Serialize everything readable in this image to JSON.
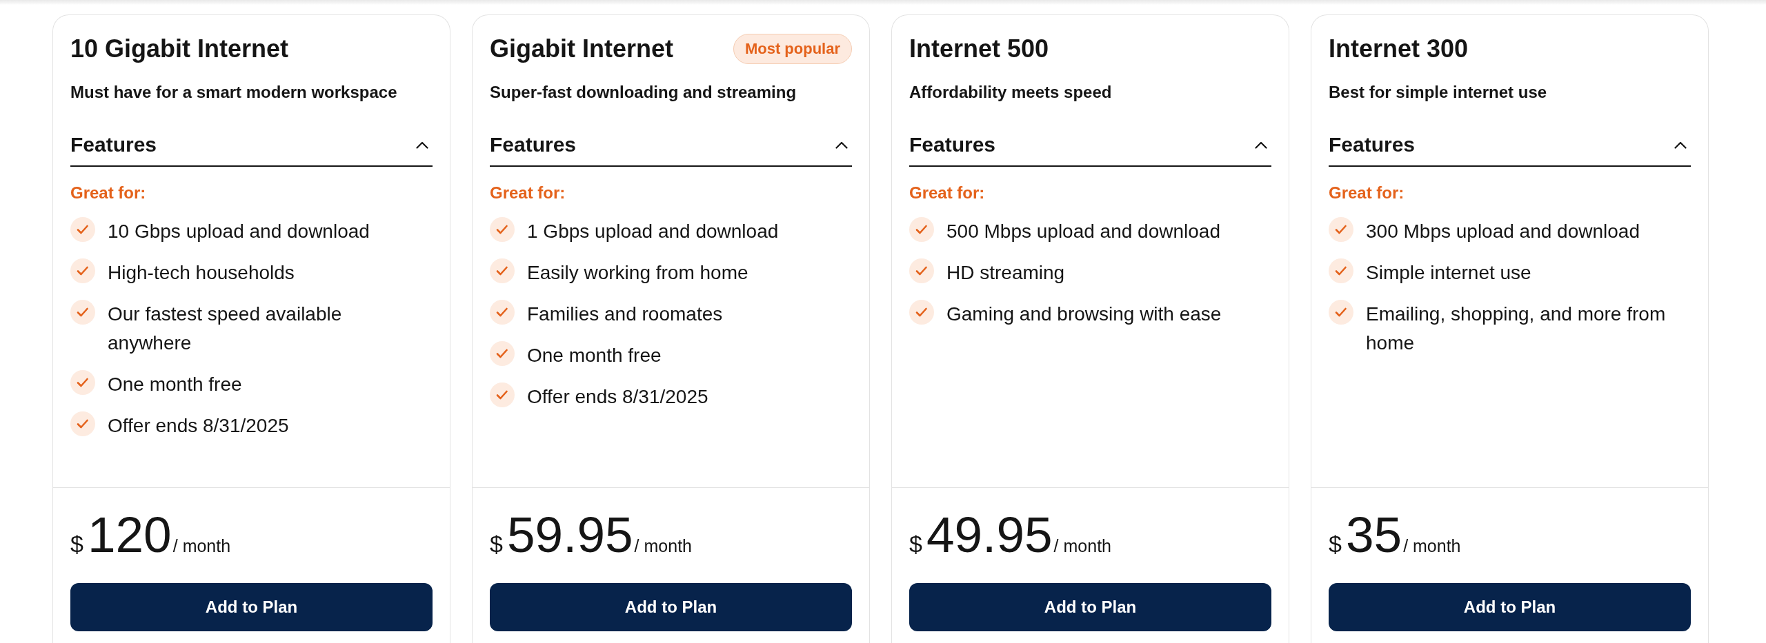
{
  "plans": [
    {
      "name": "10 Gigabit Internet",
      "tagline": "Must have for a smart modern workspace",
      "features_label": "Features",
      "features_expanded": true,
      "features_heading": "Great for:",
      "features": [
        "10 Gbps upload and download",
        "High-tech households",
        "Our fastest speed available anywhere",
        "One month free",
        "Offer ends 8/31/2025"
      ],
      "price": {
        "currency": "$",
        "amount": "120",
        "period": "/ month"
      },
      "button": "Add to Plan"
    },
    {
      "name": "Gigabit Internet",
      "badge": "Most popular",
      "tagline": "Super-fast downloading and streaming",
      "features_label": "Features",
      "features_expanded": true,
      "features_heading": "Great for:",
      "features": [
        "1 Gbps upload and download",
        "Easily working from home",
        "Families and roomates",
        "One month free",
        "Offer ends 8/31/2025"
      ],
      "price": {
        "currency": "$",
        "amount": "59.95",
        "period": "/ month"
      },
      "button": "Add to Plan"
    },
    {
      "name": "Internet 500",
      "tagline": "Affordability meets speed",
      "features_label": "Features",
      "features_expanded": true,
      "features_heading": "Great for:",
      "features": [
        "500 Mbps upload and download",
        "HD streaming",
        "Gaming and browsing with ease"
      ],
      "price": {
        "currency": "$",
        "amount": "49.95",
        "period": "/ month"
      },
      "button": "Add to Plan"
    },
    {
      "name": "Internet 300",
      "tagline": "Best for simple internet use",
      "features_label": "Features",
      "features_expanded": true,
      "features_heading": "Great for:",
      "features": [
        "300 Mbps upload and download",
        "Simple internet use",
        "Emailing, shopping, and more from home"
      ],
      "price": {
        "currency": "$",
        "amount": "35",
        "period": "/ month"
      },
      "button": "Add to Plan"
    }
  ]
}
